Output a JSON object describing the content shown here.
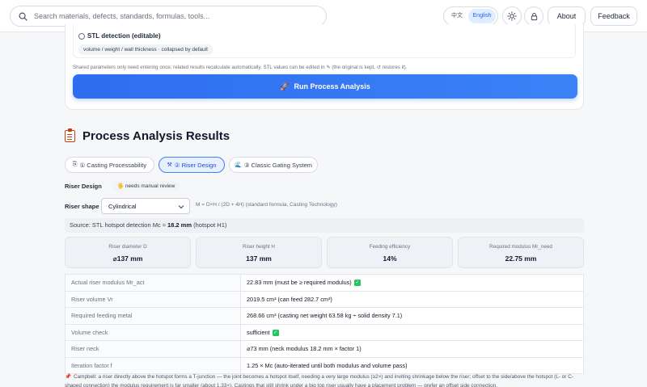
{
  "header": {
    "search_placeholder": "Search materials, defects, standards, formulas, tools...",
    "lang_zh": "中文",
    "lang_en": "English",
    "theme_icon": "sun-icon",
    "lock_icon": "lock-icon",
    "about_label": "About",
    "feedback_label": "Feedback"
  },
  "input_card": {
    "stl_title": "STL detection (editable)",
    "stl_tag": "volume / weight / wall thickness · collapsed by default",
    "shared_note": "Shared parameters only need entering once; related results recalculate automatically. STL values can be edited in ✎ (the original is kept, ↺ restores it).",
    "run_button": "Run Process Analysis"
  },
  "results": {
    "title": "Process Analysis Results",
    "tabs": [
      {
        "label": "① Casting Processability",
        "icon": "⎘"
      },
      {
        "label": "② Riser Design",
        "icon": "⚒"
      },
      {
        "label": "③ Classic Gating System",
        "icon": "🌊"
      }
    ],
    "riser_design_label": "Riser Design",
    "review_badge": "needs manual review",
    "riser_shape_label": "Riser shape",
    "riser_shape_value": "Cylindrical",
    "formula_note": "M = D×H / (2D + 4H) (standard formula, Casting Technology)",
    "source_prefix": "Source: STL hotspot detection Mc ≈ ",
    "source_value": "18.2 mm",
    "source_suffix": " (hotspot H1)",
    "metrics": [
      {
        "label": "Riser diameter D",
        "value": "⌀137 mm"
      },
      {
        "label": "Riser height H",
        "value": "137 mm"
      },
      {
        "label": "Feeding efficiency",
        "value": "14%"
      },
      {
        "label": "Required modulus Mr_need",
        "value": "22.75 mm"
      }
    ],
    "table": [
      {
        "key": "Actual riser modulus Mr_act",
        "value": "22.83 mm  (must be ≥ required modulus)"
      },
      {
        "key": "Riser volume Vr",
        "value": "2019.5 cm³  (can feed 282.7 cm³)"
      },
      {
        "key": "Required feeding metal",
        "value": "268.66 cm³  (casting net weight 63.58 kg ÷ solid density 7.1)"
      },
      {
        "key": "Volume check",
        "value": "sufficient"
      },
      {
        "key": "Riser neck",
        "value": "⌀73 mm  (neck modulus 18.2 mm × factor 1)"
      },
      {
        "key": "Iteration factor f",
        "value": "1.25 × Mc  (auto-iterated until both modulus and volume pass)"
      }
    ],
    "footnote": "Campbell: a riser directly above the hotspot forms a T-junction — the joint becomes a hotspot itself, needing a very large modulus (≥2×) and inviting shrinkage below the riser; offset to the side/above the hotspot (L- or C-shaped connection) the modulus requirement is far smaller (about 1.33×). Castings that still shrink under a big top riser usually have a placement problem — prefer an offset side connection."
  }
}
